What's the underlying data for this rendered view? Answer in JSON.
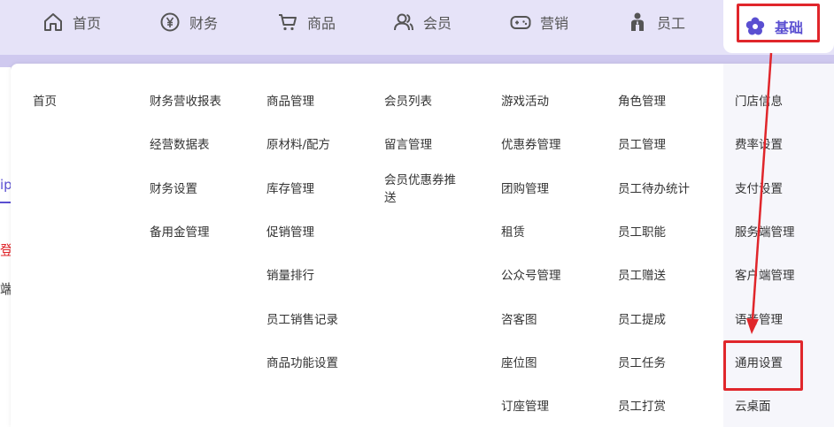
{
  "nav": {
    "items": [
      {
        "label": "首页",
        "icon": "home-icon"
      },
      {
        "label": "财务",
        "icon": "yen-icon"
      },
      {
        "label": "商品",
        "icon": "cart-icon"
      },
      {
        "label": "会员",
        "icon": "users-icon"
      },
      {
        "label": "营销",
        "icon": "gamepad-icon"
      },
      {
        "label": "员工",
        "icon": "staff-icon"
      },
      {
        "label": "基础",
        "icon": "flower-icon"
      }
    ],
    "active_index": 6,
    "accent_color": "#5a4fd1",
    "highlight_color": "#e0262b"
  },
  "background_fragments": [
    "ip",
    "登",
    "端"
  ],
  "menu": {
    "columns": [
      {
        "items": [
          "首页"
        ]
      },
      {
        "items": [
          "财务营收报表",
          "经营数据表",
          "财务设置",
          "备用金管理"
        ]
      },
      {
        "items": [
          "商品管理",
          "原材料/配方",
          "库存管理",
          "促销管理",
          "销量排行",
          "员工销售记录",
          "商品功能设置"
        ]
      },
      {
        "items": [
          "会员列表",
          "留言管理",
          "会员优惠券推送"
        ]
      },
      {
        "items": [
          "游戏活动",
          "优惠券管理",
          "团购管理",
          "租赁",
          "公众号管理",
          "咨客图",
          "座位图",
          "订座管理"
        ]
      },
      {
        "items": [
          "角色管理",
          "员工管理",
          "员工待办统计",
          "员工职能",
          "员工赠送",
          "员工提成",
          "员工任务",
          "员工打赏"
        ]
      },
      {
        "items": [
          "门店信息",
          "费率设置",
          "支付设置",
          "服务端管理",
          "客户端管理",
          "语音管理",
          "通用设置",
          "云桌面"
        ]
      }
    ]
  }
}
